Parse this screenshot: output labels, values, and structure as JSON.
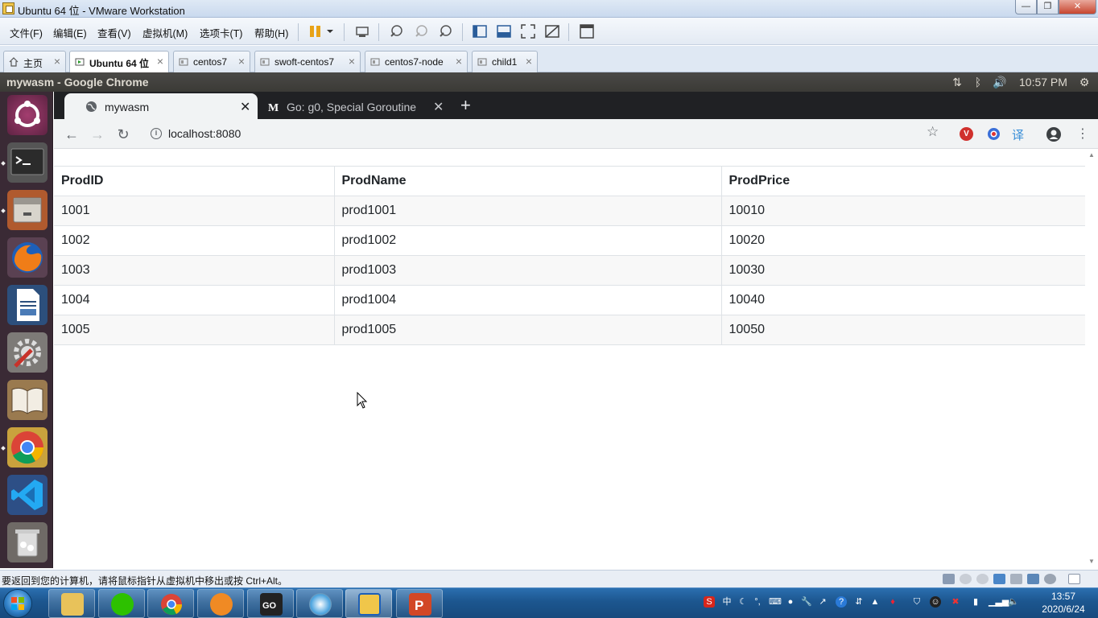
{
  "vmware": {
    "window_title": "Ubuntu 64 位 - VMware Workstation",
    "menu": [
      "文件(F)",
      "编辑(E)",
      "查看(V)",
      "虚拟机(M)",
      "选项卡(T)",
      "帮助(H)"
    ],
    "tabs": [
      {
        "label": "主页",
        "icon": "home-icon"
      },
      {
        "label": "Ubuntu 64 位",
        "icon": "vm-running-icon",
        "active": true
      },
      {
        "label": "centos7",
        "icon": "vm-icon"
      },
      {
        "label": "swoft-centos7",
        "icon": "vm-icon"
      },
      {
        "label": "centos7-node",
        "icon": "vm-icon"
      },
      {
        "label": "child1",
        "icon": "vm-icon"
      }
    ],
    "status_text": "要返回到您的计算机，请将鼠标指针从虚拟机中移出或按 Ctrl+Alt。"
  },
  "ubuntu": {
    "panel_title": "mywasm - Google Chrome",
    "clock": "10:57 PM",
    "launcher": [
      "ubuntu-dash-icon",
      "terminal-icon",
      "files-icon",
      "firefox-icon",
      "writer-icon",
      "settings-icon",
      "reader-icon",
      "chrome-icon",
      "vscode-icon",
      "trash-icon"
    ]
  },
  "chrome": {
    "tabs": [
      {
        "title": "mywasm",
        "active": true
      },
      {
        "title": "Go: g0, Special Goroutine",
        "active": false
      }
    ],
    "new_tab": "+",
    "url": "localhost:8080",
    "ext_translate": "译"
  },
  "table": {
    "headers": [
      "ProdID",
      "ProdName",
      "ProdPrice"
    ],
    "rows": [
      [
        "1001",
        "prod1001",
        "10010"
      ],
      [
        "1002",
        "prod1002",
        "10020"
      ],
      [
        "1003",
        "prod1003",
        "10030"
      ],
      [
        "1004",
        "prod1004",
        "10040"
      ],
      [
        "1005",
        "prod1005",
        "10050"
      ]
    ]
  },
  "windows": {
    "time": "13:57",
    "date": "2020/6/24",
    "ime": "中"
  },
  "colors": {
    "vm_tab_active": "#ffffff",
    "chrome_dark": "#202124",
    "ubuntu_launcher": "#3a2a35",
    "taskbar": "#1c568f"
  }
}
